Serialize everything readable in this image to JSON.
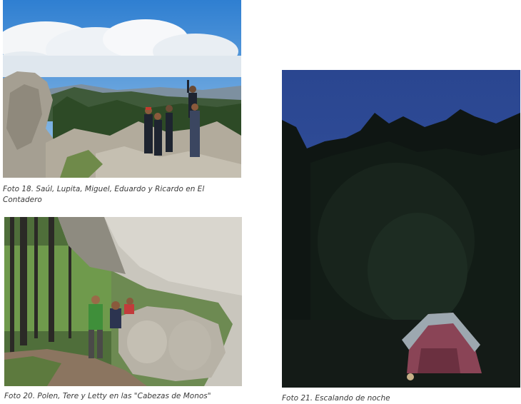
{
  "photos": [
    {
      "id": "foto18",
      "caption": "Foto 18. Saúl, Lupita, Miguel, Eduardo y Ricardo en El Contadero"
    },
    {
      "id": "foto20",
      "caption": "Foto 20. Polen, Tere y Letty en las \"Cabezas de Monos\""
    },
    {
      "id": "foto21",
      "caption": "Foto 21. Escalando de noche"
    }
  ]
}
